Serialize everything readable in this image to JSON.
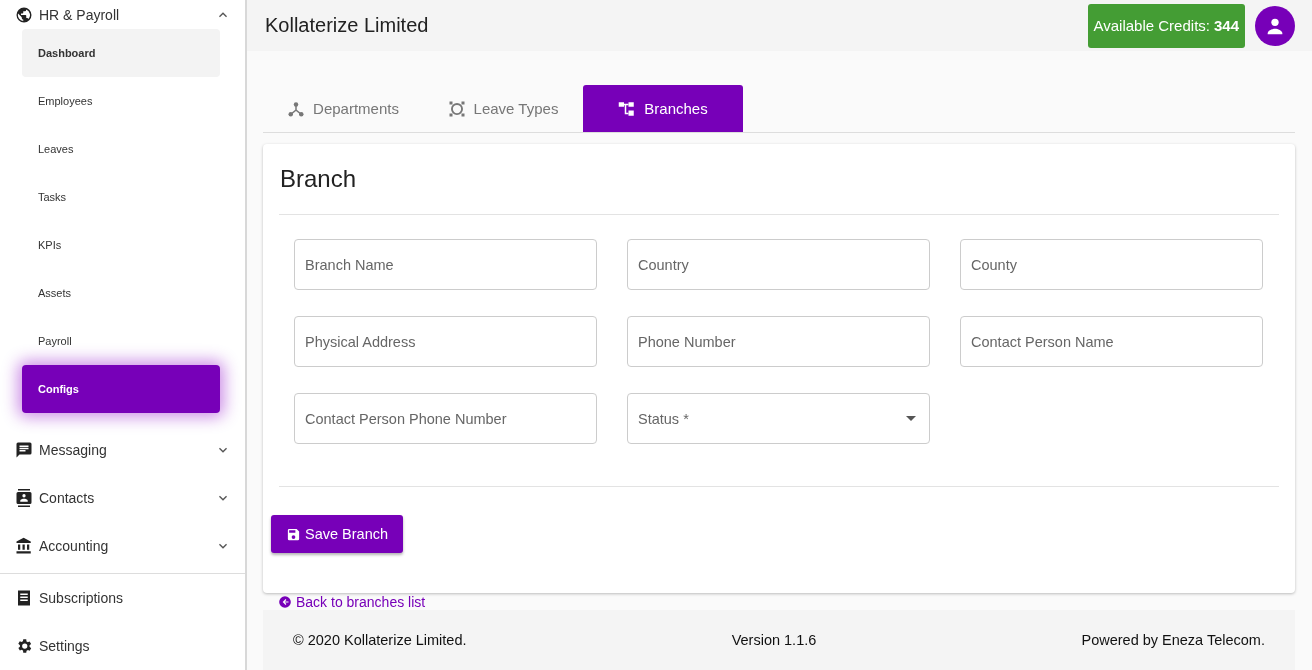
{
  "sidebar": {
    "group": {
      "label": "HR & Payroll",
      "expanded": true,
      "children": [
        {
          "label": "Dashboard",
          "selected": false,
          "hovered": true
        },
        {
          "label": "Employees",
          "selected": false,
          "hovered": false
        },
        {
          "label": "Leaves",
          "selected": false,
          "hovered": false
        },
        {
          "label": "Tasks",
          "selected": false,
          "hovered": false
        },
        {
          "label": "KPIs",
          "selected": false,
          "hovered": false
        },
        {
          "label": "Assets",
          "selected": false,
          "hovered": false
        },
        {
          "label": "Payroll",
          "selected": false,
          "hovered": false
        },
        {
          "label": "Configs",
          "selected": true,
          "hovered": false
        }
      ]
    },
    "items": [
      {
        "label": "Messaging",
        "expandable": true
      },
      {
        "label": "Contacts",
        "expandable": true
      },
      {
        "label": "Accounting",
        "expandable": true
      }
    ],
    "bottom_items": [
      {
        "label": "Subscriptions"
      },
      {
        "label": "Settings"
      }
    ]
  },
  "header": {
    "title": "Kollaterize Limited",
    "credits_label": "Available Credits:",
    "credits_value": "344"
  },
  "tabs": [
    {
      "label": "Departments",
      "selected": false
    },
    {
      "label": "Leave Types",
      "selected": false
    },
    {
      "label": "Branches",
      "selected": true
    }
  ],
  "form": {
    "title": "Branch",
    "fields": [
      {
        "placeholder": "Branch Name",
        "kind": "text"
      },
      {
        "placeholder": "Country",
        "kind": "text"
      },
      {
        "placeholder": "County",
        "kind": "text"
      },
      {
        "placeholder": "Physical Address",
        "kind": "text"
      },
      {
        "placeholder": "Phone Number",
        "kind": "text"
      },
      {
        "placeholder": "Contact Person Name",
        "kind": "text"
      },
      {
        "placeholder": "Contact Person Phone Number",
        "kind": "text"
      },
      {
        "placeholder": "Status *",
        "kind": "select"
      }
    ],
    "save_button": "Save Branch"
  },
  "back_link": "Back to branches list",
  "footer": {
    "copyright": "© 2020 Kollaterize Limited.",
    "version": "Version 1.1.6",
    "powered_by": "Powered by Eneza Telecom."
  }
}
